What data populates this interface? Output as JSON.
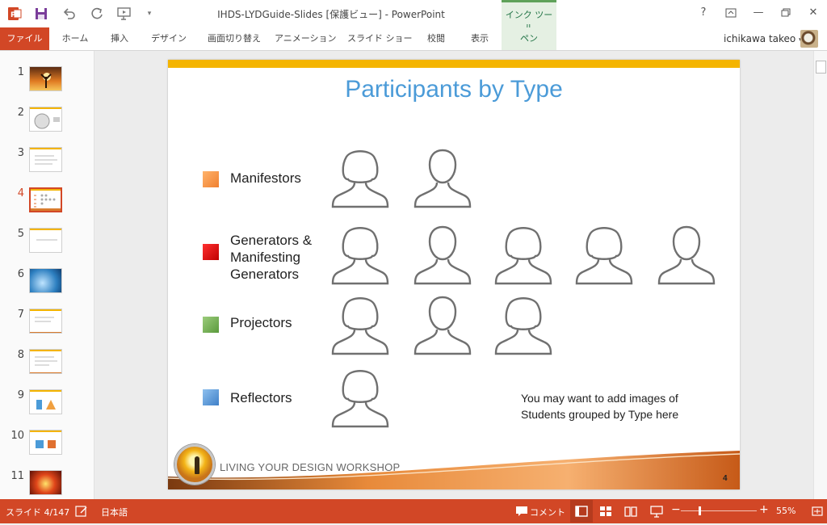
{
  "titlebar": {
    "title": "IHDS-LYDGuide-Slides [保護ビュー] - PowerPoint",
    "contextual_group": "インク ツール",
    "help": "?",
    "minimize": "—",
    "close": "✕",
    "qat_dropdown": "▾"
  },
  "ribbon": {
    "tabs": [
      "ファイル",
      "ホーム",
      "挿入",
      "デザイン",
      "画面切り替え",
      "アニメーション",
      "スライド ショー",
      "校閲",
      "表示",
      "ペン"
    ],
    "user": "ichikawa takeo",
    "user_caret": "▾"
  },
  "thumbnails": {
    "numbers": [
      "1",
      "2",
      "3",
      "4",
      "5",
      "6",
      "7",
      "8",
      "9",
      "10",
      "11"
    ],
    "active": "4"
  },
  "slide": {
    "title": "Participants by Type",
    "categories": [
      {
        "label": "Manifestors",
        "color": "#f79646",
        "female": 1,
        "male": 1
      },
      {
        "label": "Generators &\nManifesting\nGenerators",
        "color": "#e10000",
        "female": 4,
        "male": 1
      },
      {
        "label": "Projectors",
        "color": "#70ad47",
        "female": 2,
        "male": 1
      },
      {
        "label": "Reflectors",
        "color": "#5b9bd5",
        "female": 1,
        "male": 0
      }
    ],
    "note": "You may want to add images of Students grouped by Type here",
    "footer_text": "LIVING YOUR DESIGN WORKSHOP",
    "page_number": "4"
  },
  "statusbar": {
    "slide_indicator": "スライド 4/147",
    "language": "日本語",
    "comments": "コメント",
    "zoom_minus": "−",
    "zoom_plus": "+",
    "zoom": "55%"
  }
}
